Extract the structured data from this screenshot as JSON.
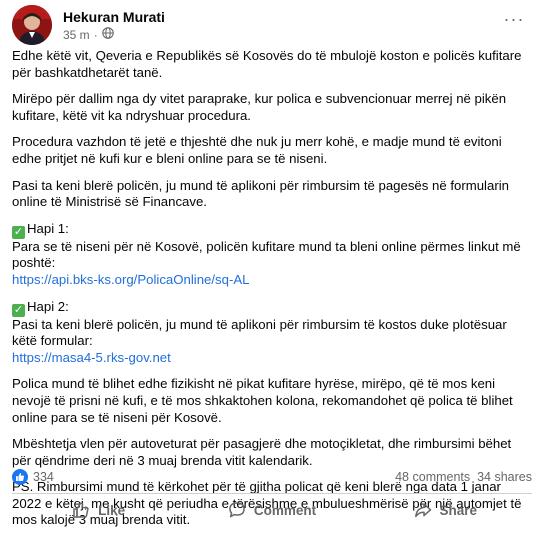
{
  "post": {
    "author": "Hekuran Murati",
    "time": "35 m",
    "dot": "·",
    "more": "···",
    "paragraphs": [
      "Edhe këtë vit, Qeveria e Republikës së Kosovës do të mbulojë koston e policës kufitare për bashkatdhetarët tanë.",
      "Mirëpo për dallim nga dy vitet paraprake, kur polica e subvencionuar merrej në pikën kufitare, këtë vit ka ndryshuar procedura.",
      "Procedura vazhdon të jetë e thjeshtë dhe nuk ju merr kohë, e madje mund të evitoni edhe pritjet në kufi kur e bleni online para se të niseni.",
      "Pasi ta keni blerë policën, ju mund të aplikoni për rimbursim të pagesës në formularin online të Ministrisë së Financave."
    ],
    "step1_title": "Hapi 1:",
    "step1_text": "Para se të niseni për në Kosovë, policën kufitare mund ta bleni online përmes linkut më poshtë:",
    "step1_link": "https://api.bks-ks.org/PolicaOnline/sq-AL",
    "step2_title": "Hapi 2:",
    "step2_text": "Pasi ta keni blerë policën, ju mund të aplikoni për rimbursim të kostos duke plotësuar këtë formular:",
    "step2_link": "https://masa4-5.rks-gov.net",
    "paragraphs2": [
      "Polica mund të blihet edhe fizikisht në pikat kufitare hyrëse, mirëpo, që të mos keni nevojë të prisni në kufi, e të mos shkaktohen kolona, rekomandohet që polica të blihet online para se të niseni për Kosovë.",
      "Mbështetja vlen për autoveturat për pasagjerë dhe motoçikletat, dhe rimbursimi bëhet për qëndrime deri në 3 muaj brenda vitit kalendarik.",
      "PS. Rimbursimi mund të kërkohet për të gjitha policat që keni blerë nga data 1 janar 2022 e këtej, me kusht që periudha e tërësishme e mbulueshmërisë për një automjet të mos kalojë 3 muaj brenda vitit."
    ]
  },
  "stats": {
    "reactions": "334",
    "comments": "48 comments",
    "shares": "34 shares"
  },
  "actions": {
    "like": "Like",
    "comment": "Comment",
    "share": "Share"
  },
  "colors": {
    "link": "#216fdb",
    "facebook_blue": "#1877f2",
    "secondary_text": "#65676b",
    "check_green": "#4caf50"
  },
  "icons": [
    "globe-icon",
    "more-icon",
    "check-icon",
    "like-reaction-icon",
    "like-icon",
    "comment-icon",
    "share-icon"
  ]
}
